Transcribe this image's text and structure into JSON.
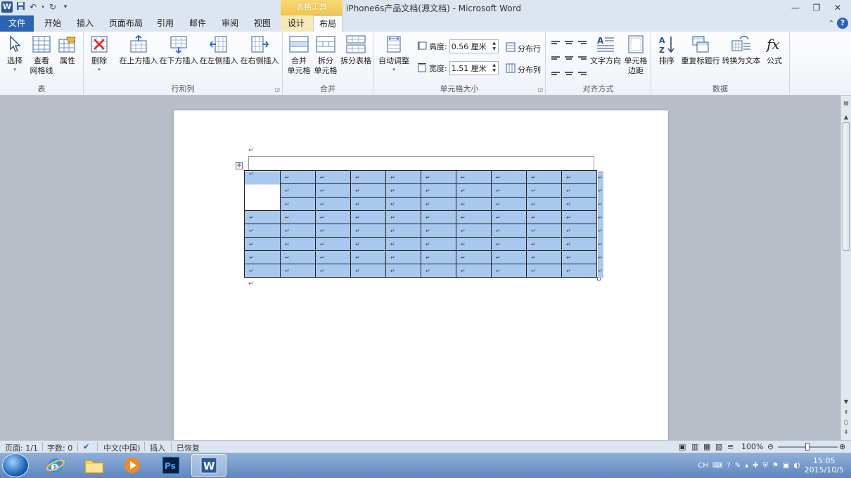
{
  "titlebar": {
    "context_tab_group": "表格工具",
    "document_title": "iPhone6s产品文档(源文档)  -  Microsoft Word",
    "window_buttons": [
      "—",
      "❐",
      "✕"
    ]
  },
  "tabs": {
    "file": "文件",
    "items": [
      "开始",
      "插入",
      "页面布局",
      "引用",
      "邮件",
      "审阅",
      "视图",
      "设计",
      "布局"
    ],
    "active": "布局"
  },
  "ribbon": {
    "group_table": {
      "label": "表",
      "select": "选择",
      "gridlines_line1": "查看",
      "gridlines_line2": "网格线",
      "properties": "属性"
    },
    "group_rows_cols": {
      "label": "行和列",
      "delete": "删除",
      "insert_above": "在上方插入",
      "insert_below": "在下方插入",
      "insert_left": "在左侧插入",
      "insert_right": "在右侧插入"
    },
    "group_merge": {
      "label": "合并",
      "merge_line1": "合并",
      "merge_line2": "单元格",
      "split_line1": "拆分",
      "split_line2": "单元格",
      "split_table": "拆分表格"
    },
    "group_cell_size": {
      "label": "单元格大小",
      "autofit": "自动调整",
      "height_label": "高度:",
      "height_value": "0.56 厘米",
      "width_label": "宽度:",
      "width_value": "1.51 厘米",
      "distribute_rows": "分布行",
      "distribute_cols": "分布列"
    },
    "group_alignment": {
      "label": "对齐方式",
      "text_direction": "文字方向",
      "cell_margins_line1": "单元格",
      "cell_margins_line2": "边距"
    },
    "group_data": {
      "label": "数据",
      "sort": "排序",
      "repeat_header": "重复标题行",
      "convert_text": "转换为文本",
      "formula": "公式"
    }
  },
  "document": {
    "paragraph_mark": "↵",
    "table_rows": 8,
    "table_cols": 10,
    "merged_first_col_rows": 3
  },
  "statusbar": {
    "page": "页面: 1/1",
    "words": "字数: 0",
    "language": "中文(中国)",
    "mode": "插入",
    "recovered": "已恢复",
    "zoom": "100%"
  },
  "taskbar": {
    "time": "15:05",
    "date": "2015/10/5",
    "ime": "CH"
  },
  "colors": {
    "file_tab": "#2b63b5",
    "context_tab": "#f1c44a",
    "cell_selection": "#a8c8ee",
    "taskbar": "#5f86bf"
  }
}
